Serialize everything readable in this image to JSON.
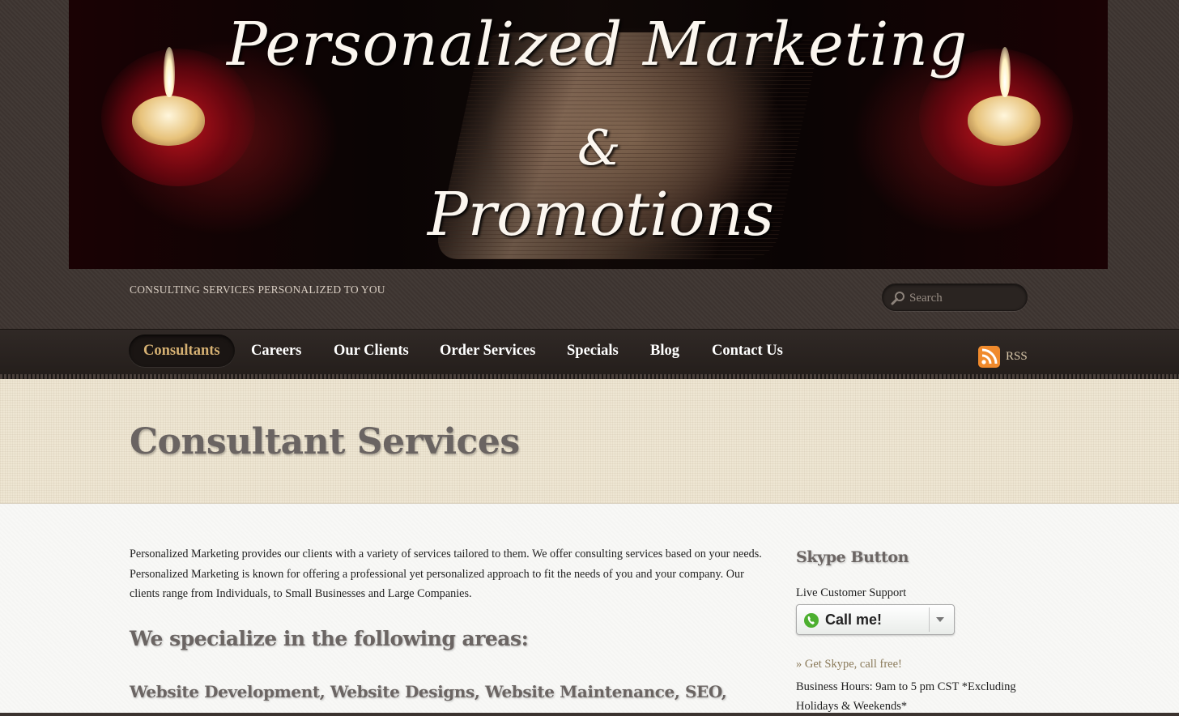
{
  "banner": {
    "line1": "Personalized Marketing",
    "line2": "&",
    "line3": "Promotions"
  },
  "header": {
    "tagline": "CONSULTING SERVICES PERSONALIZED TO YOU"
  },
  "search": {
    "placeholder": "Search",
    "value": ""
  },
  "nav": {
    "items": [
      {
        "label": "Consultants",
        "active": true
      },
      {
        "label": "Careers"
      },
      {
        "label": "Our Clients"
      },
      {
        "label": "Order Services"
      },
      {
        "label": "Specials"
      },
      {
        "label": "Blog"
      },
      {
        "label": "Contact Us"
      }
    ],
    "rss_label": "RSS"
  },
  "page": {
    "title": "Consultant Services",
    "intro": "Personalized Marketing provides our clients with a variety of services tailored to them. We offer consulting services based on your needs. Personalized Marketing is known for offering a professional yet personalized approach to fit the needs of you and your company. Our clients range from Individuals, to Small Businesses and Large Companies.",
    "specialize_heading": "We specialize in the following areas:",
    "services_heading": "Website Development, Website Designs, Website Maintenance, SEO,"
  },
  "sidebar": {
    "widget_title": "Skype Button",
    "support_label": "Live Customer Support",
    "call_label": "Call me!",
    "get_skype": "» Get Skype, call free!",
    "hours": "Business Hours: 9am to 5 pm CST *Excluding Holidays & Weekends*"
  },
  "colors": {
    "header_bg": "#3e3531",
    "nav_bg": "#241e1b",
    "nav_active_text": "#d6b173",
    "title_band_bg": "#eee6d3",
    "content_bg": "#f8f8f6",
    "heading_text": "#6b6563",
    "rss_orange": "#f08a2c",
    "link_color": "#8a7a5a"
  },
  "icons": {
    "search": "search-icon",
    "rss": "rss-icon",
    "skype": "skype-icon",
    "dropdown": "chevron-down-icon"
  }
}
